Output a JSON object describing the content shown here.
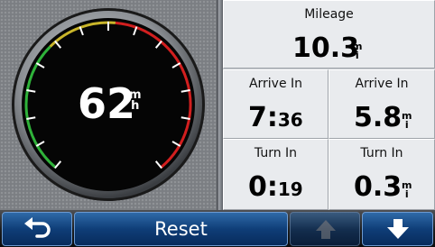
{
  "speedometer": {
    "speed": "62",
    "unit_top": "m",
    "unit_bottom": "h",
    "colors": {
      "green": "#2fb23a",
      "yellow": "#c9b52a",
      "red": "#d21f1f"
    }
  },
  "trip": {
    "mileage": {
      "label": "Mileage",
      "value": "10.3",
      "unit_top": "m",
      "unit_bottom": "i"
    },
    "arrive_time": {
      "label": "Arrive In",
      "value_main": "7:",
      "value_small": "36"
    },
    "arrive_distance": {
      "label": "Arrive In",
      "value": "5.8",
      "unit_top": "m",
      "unit_bottom": "i"
    },
    "turn_time": {
      "label": "Turn In",
      "value_main": "0:",
      "value_small": "19"
    },
    "turn_distance": {
      "label": "Turn In",
      "value": "0.3",
      "unit_top": "m",
      "unit_bottom": "i"
    }
  },
  "toolbar": {
    "back_icon": "back-arrow-icon",
    "reset_label": "Reset",
    "up_icon": "up-arrow-icon",
    "down_icon": "down-arrow-icon"
  }
}
